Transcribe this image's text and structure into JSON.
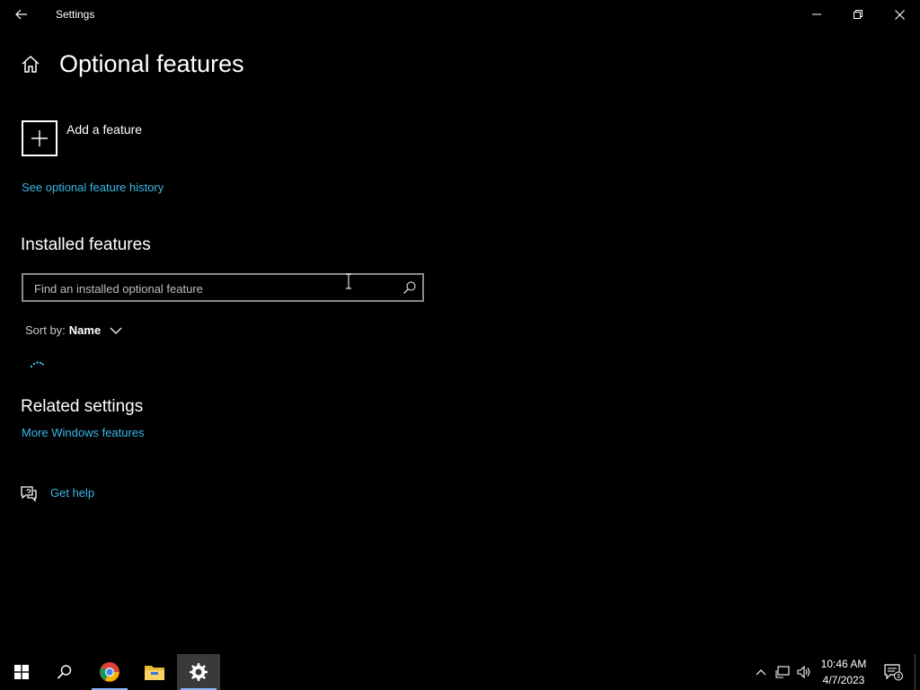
{
  "window": {
    "title": "Settings"
  },
  "page": {
    "title": "Optional features",
    "add_feature_label": "Add a feature",
    "history_link": "See optional feature history"
  },
  "installed": {
    "heading": "Installed features",
    "search_placeholder": "Find an installed optional feature",
    "search_value": "",
    "sort_label": "Sort by:",
    "sort_value": "Name"
  },
  "related": {
    "heading": "Related settings",
    "more_windows_features": "More Windows features"
  },
  "help": {
    "label": "Get help"
  },
  "taskbar": {
    "apps": [
      {
        "name": "start",
        "icon": "windows-logo-icon"
      },
      {
        "name": "search",
        "icon": "search-icon"
      },
      {
        "name": "chrome",
        "icon": "chrome-icon"
      },
      {
        "name": "file-explorer",
        "icon": "folder-icon"
      },
      {
        "name": "settings",
        "icon": "gear-icon",
        "active": true
      }
    ],
    "time": "10:46 AM",
    "date": "4/7/2023",
    "notification_count": "3"
  },
  "colors": {
    "link": "#3ab8e8",
    "background": "#000000",
    "active_taskbar": "#3a3a3a"
  }
}
